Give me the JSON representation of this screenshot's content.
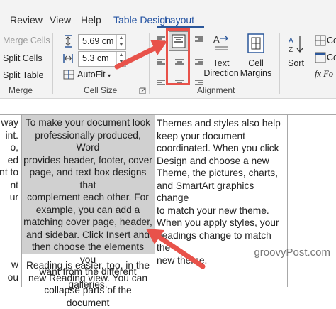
{
  "tabs": [
    {
      "label": "Review"
    },
    {
      "label": "View"
    },
    {
      "label": "Help"
    },
    {
      "label": "Table Design"
    },
    {
      "label": "Layout"
    }
  ],
  "merge_group": {
    "merge_cells": "Merge Cells",
    "split_cells": "Split Cells",
    "split_table": "Split Table",
    "label": "Merge"
  },
  "cell_size_group": {
    "height_value": "5.69 cm",
    "width_value": "5.3 cm",
    "autofit": "AutoFit",
    "label": "Cell Size"
  },
  "alignment_group": {
    "text_direction": "Text Direction",
    "text_direction_l1": "Text",
    "text_direction_l2": "Direction",
    "cell_margins_l1": "Cell",
    "cell_margins_l2": "Margins",
    "label": "Alignment"
  },
  "data_group": {
    "sort": "Sort",
    "convert_initial": "Co",
    "formula_initial": "Fo"
  },
  "document": {
    "left_col_lines": [
      "way",
      "int.",
      "o,",
      "ed",
      "nt to",
      "nt",
      "ur",
      ""
    ],
    "left_col_bottom": [
      "w",
      "ou"
    ],
    "middle_text_lines": [
      "To make your document look",
      "professionally produced, Word",
      "provides header, footer, cover",
      "page, and text box designs that",
      "complement each other. For",
      "example, you can add a",
      "matching cover page, header,",
      "and sidebar. Click Insert and",
      "then choose the elements you",
      "want from the different",
      "galleries."
    ],
    "right_text_lines": [
      "Themes and styles also help",
      "keep your document",
      "coordinated. When you click",
      "Design and choose a new",
      "Theme, the pictures, charts,",
      "and SmartArt graphics change",
      "to match your new theme.",
      "When you apply styles, your",
      "headings change to match the",
      "new theme."
    ],
    "middle_bottom_lines": [
      "Reading is easier, too, in the",
      "new Reading view. You can",
      "collapse parts of the document"
    ]
  },
  "watermark": "groovyPost.com",
  "colors": {
    "accent": "#2b579a",
    "arrow": "#e8524a",
    "highlight": "#d0d0d0",
    "ribbon_bg": "#f3f3f3"
  }
}
